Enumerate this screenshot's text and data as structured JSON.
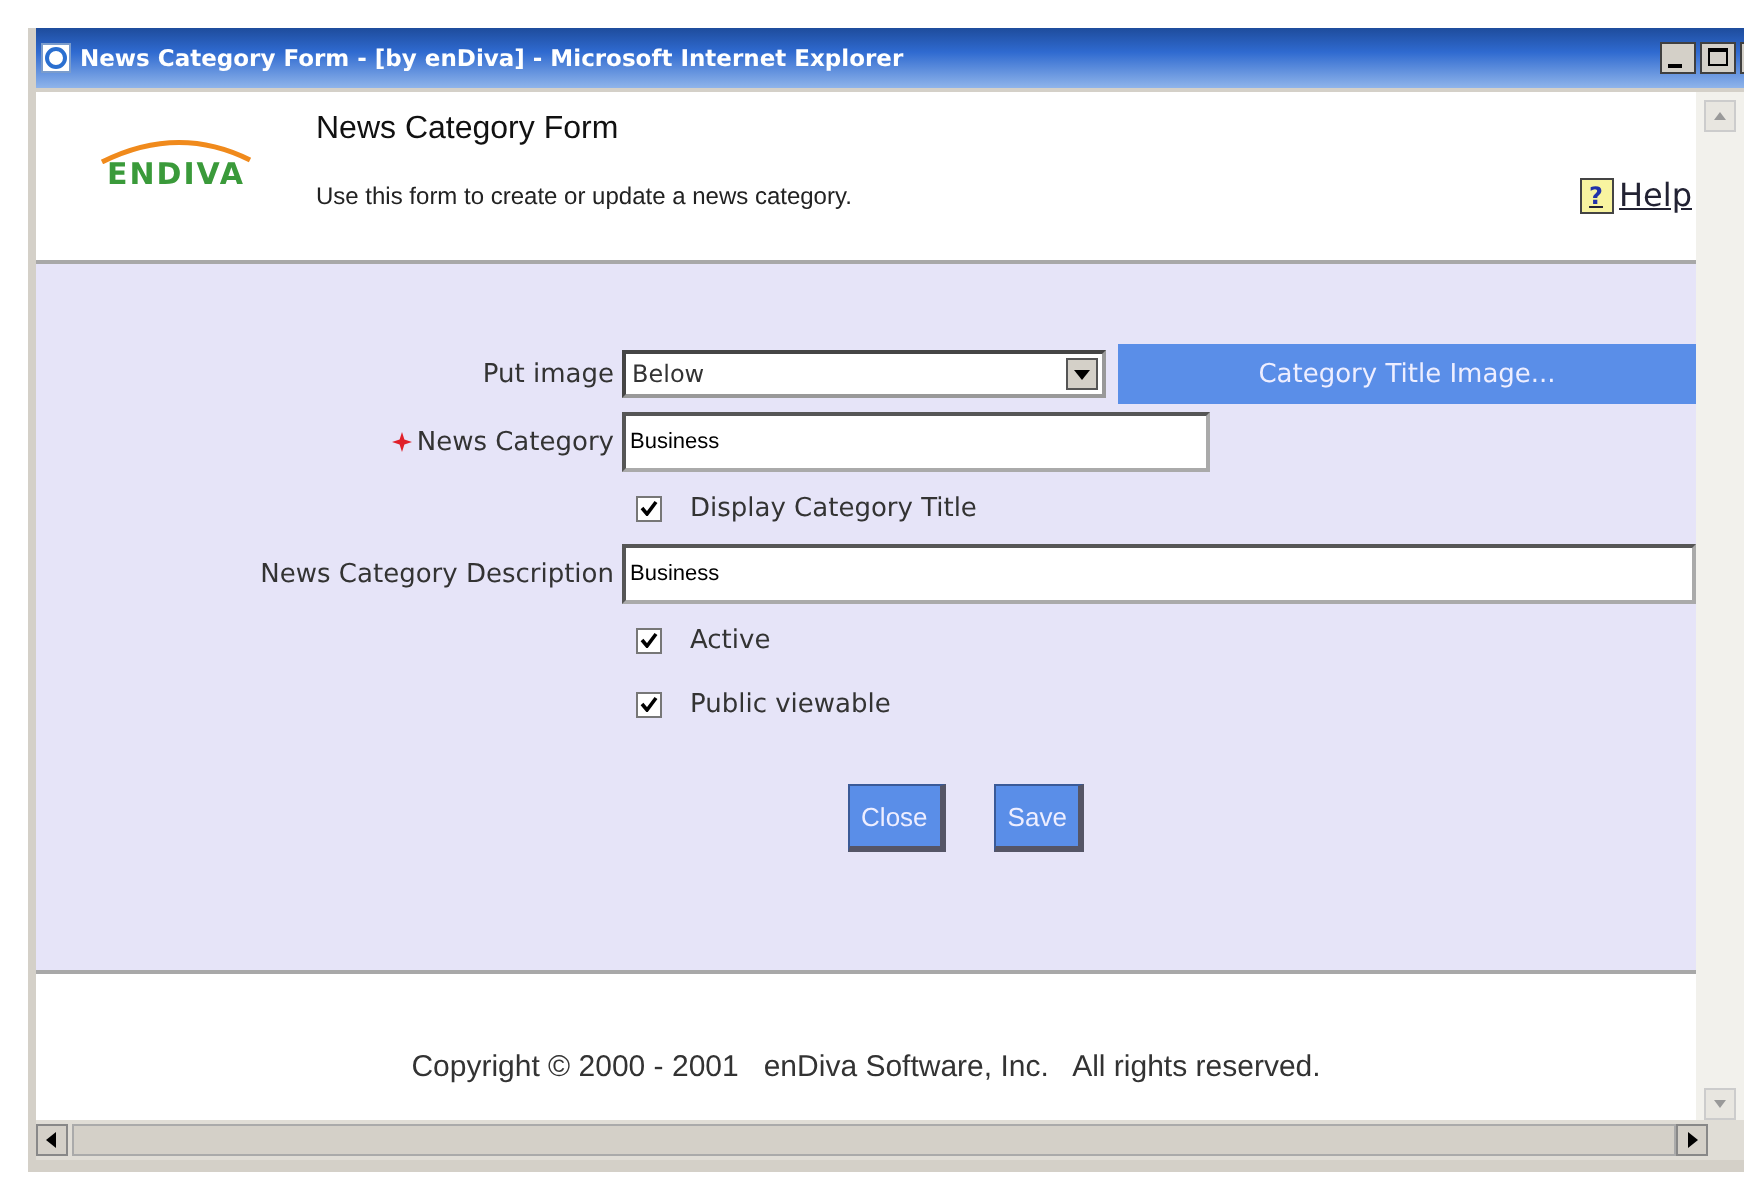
{
  "window": {
    "title": "News Category Form - [by enDiva] - Microsoft Internet Explorer"
  },
  "header": {
    "logo": "ENDIVA",
    "title": "News Category Form",
    "subtitle": "Use this form to create or update a news category.",
    "help_mark": "?",
    "help": "Help"
  },
  "form": {
    "rows": [
      {
        "kind": "select",
        "label": "Put image",
        "required": false,
        "value": "Below",
        "button": "Category Title Image..."
      },
      {
        "kind": "text",
        "label": "News Category",
        "required": true,
        "value": "Business"
      },
      {
        "kind": "checkbox",
        "label": "Display Category Title",
        "checked": true
      },
      {
        "kind": "wide_text",
        "label": "News Category Description",
        "required": false,
        "value": "Business"
      },
      {
        "kind": "checkbox",
        "label": "Active",
        "checked": true
      },
      {
        "kind": "checkbox",
        "label": "Public viewable",
        "checked": true
      }
    ],
    "buttons": [
      "Close",
      "Save"
    ]
  },
  "footer": "Copyright © 2000 - 2001   enDiva Software, Inc.   All rights reserved."
}
